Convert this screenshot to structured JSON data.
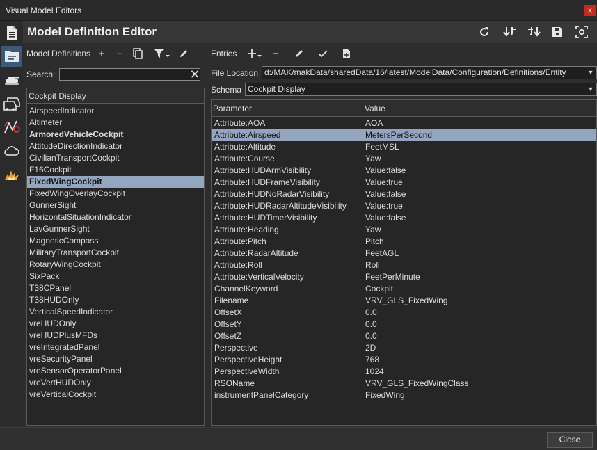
{
  "window": {
    "title": "Visual Model Editors",
    "close_glyph": "x"
  },
  "header": {
    "title": "Model Definition Editor"
  },
  "sidebar": {
    "items": [
      {
        "icon": "document-icon"
      },
      {
        "icon": "model-definition-icon",
        "active": true
      },
      {
        "icon": "tank-icon"
      },
      {
        "icon": "vehicles-icon"
      },
      {
        "icon": "signal-path-icon"
      },
      {
        "icon": "cloud-icon"
      },
      {
        "icon": "explosion-icon"
      }
    ]
  },
  "header_actions": [
    "refresh-icon",
    "import-icon",
    "export-icon",
    "save-icon",
    "fit-icon"
  ],
  "left": {
    "label": "Model Definitions",
    "search_label": "Search:",
    "search_value": "",
    "list_header": "Cockpit Display",
    "items": [
      {
        "label": "AirspeedIndicator"
      },
      {
        "label": "Altimeter"
      },
      {
        "label": "ArmoredVehicleCockpit",
        "bold": true
      },
      {
        "label": "AttitudeDirectionIndicator"
      },
      {
        "label": "CivilianTransportCockpit"
      },
      {
        "label": "F16Cockpit"
      },
      {
        "label": "FixedWingCockpit",
        "selected": true
      },
      {
        "label": "FixedWingOverlayCockpit"
      },
      {
        "label": "GunnerSight"
      },
      {
        "label": "HorizontalSituationIndicator"
      },
      {
        "label": "LavGunnerSight"
      },
      {
        "label": "MagneticCompass"
      },
      {
        "label": "MilitaryTransportCockpit"
      },
      {
        "label": "RotaryWingCockpit"
      },
      {
        "label": "SixPack"
      },
      {
        "label": "T38CPanel"
      },
      {
        "label": "T38HUDOnly"
      },
      {
        "label": "VerticalSpeedIndicator"
      },
      {
        "label": "vreHUDOnly"
      },
      {
        "label": "vreHUDPlusMFDs"
      },
      {
        "label": "vreIntegratedPanel"
      },
      {
        "label": "vreSecurityPanel"
      },
      {
        "label": "vreSensorOperatorPanel"
      },
      {
        "label": "vreVertHUDOnly"
      },
      {
        "label": "vreVerticalCockpit"
      }
    ]
  },
  "right": {
    "label": "Entries",
    "file_location_label": "File Location",
    "file_location_value": "d:/MAK/makData/sharedData/16/latest/ModelData/Configuration/Definitions/Entity",
    "schema_label": "Schema",
    "schema_value": "Cockpit Display",
    "columns": [
      "Parameter",
      "Value"
    ],
    "rows": [
      {
        "param": "Attribute:AOA",
        "value": "AOA"
      },
      {
        "param": "Attribute:Airspeed",
        "value": "MetersPerSecond",
        "selected": true
      },
      {
        "param": "Attribute:Altitude",
        "value": "FeetMSL"
      },
      {
        "param": "Attribute:Course",
        "value": "Yaw"
      },
      {
        "param": "Attribute:HUDArmVisibility",
        "value": "Value:false"
      },
      {
        "param": "Attribute:HUDFrameVisibility",
        "value": "Value:true"
      },
      {
        "param": "Attribute:HUDNoRadarVisibility",
        "value": "Value:false"
      },
      {
        "param": "Attribute:HUDRadarAltitudeVisibility",
        "value": "Value:true"
      },
      {
        "param": "Attribute:HUDTimerVisibility",
        "value": "Value:false"
      },
      {
        "param": "Attribute:Heading",
        "value": "Yaw"
      },
      {
        "param": "Attribute:Pitch",
        "value": "Pitch"
      },
      {
        "param": "Attribute:RadarAltitude",
        "value": "FeetAGL"
      },
      {
        "param": "Attribute:Roll",
        "value": "Roll"
      },
      {
        "param": "Attribute:VerticalVelocity",
        "value": "FeetPerMinute"
      },
      {
        "param": "ChannelKeyword",
        "value": "Cockpit"
      },
      {
        "param": "Filename",
        "value": "VRV_GLS_FixedWing"
      },
      {
        "param": "OffsetX",
        "value": "0.0"
      },
      {
        "param": "OffsetY",
        "value": "0.0"
      },
      {
        "param": "OffsetZ",
        "value": "0.0"
      },
      {
        "param": "Perspective",
        "value": "2D"
      },
      {
        "param": "PerspectiveHeight",
        "value": "768"
      },
      {
        "param": "PerspectiveWidth",
        "value": "1024"
      },
      {
        "param": "RSOName",
        "value": "VRV_GLS_FixedWingClass"
      },
      {
        "param": "instrumentPanelCategory",
        "value": "FixedWing"
      }
    ]
  },
  "footer": {
    "close_label": "Close"
  },
  "colors": {
    "selection": "#94a5bf",
    "active_tab": "#3b5a78",
    "close_red": "#c42b1c"
  }
}
